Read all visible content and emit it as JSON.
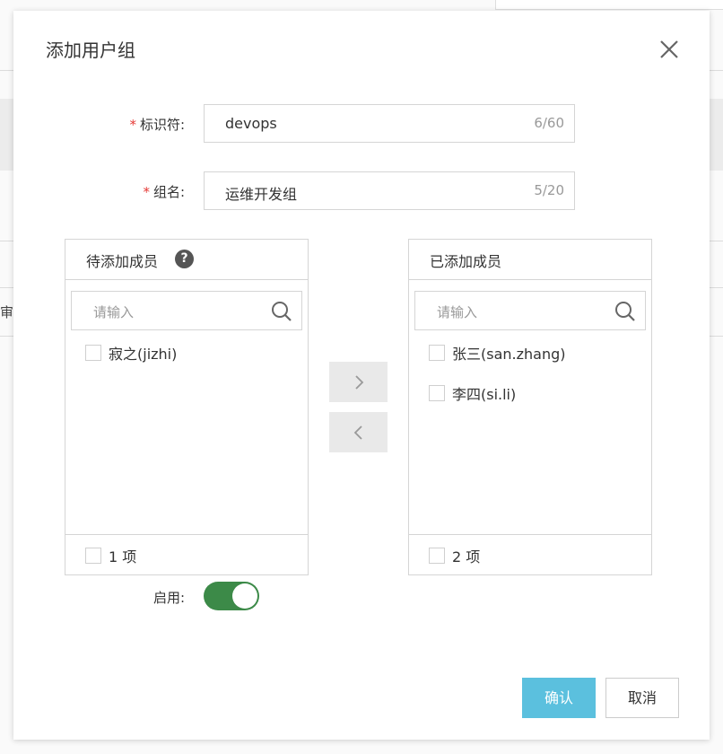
{
  "background": {
    "cut_text": "审计"
  },
  "dialog": {
    "title": "添加用户组"
  },
  "form": {
    "identifier": {
      "label": "标识符:",
      "value": "devops",
      "count": "6/60",
      "required_mark": "*"
    },
    "group_name": {
      "label": "组名:",
      "value": "运维开发组",
      "count": "5/20",
      "required_mark": "*"
    },
    "enabled": {
      "label": "启用:",
      "on": true
    }
  },
  "transfer": {
    "left": {
      "title": "待添加成员",
      "help": "?",
      "search_placeholder": "请输入",
      "items": [
        "寂之(jizhi)"
      ],
      "footer": "1 项"
    },
    "right": {
      "title": "已添加成员",
      "search_placeholder": "请输入",
      "items": [
        "张三(san.zhang)",
        "李四(si.li)"
      ],
      "footer": "2 项"
    }
  },
  "buttons": {
    "confirm": "确认",
    "cancel": "取消"
  },
  "colors": {
    "primary": "#5bc0de",
    "switch_on": "#3c8a48",
    "required": "#e53935"
  }
}
